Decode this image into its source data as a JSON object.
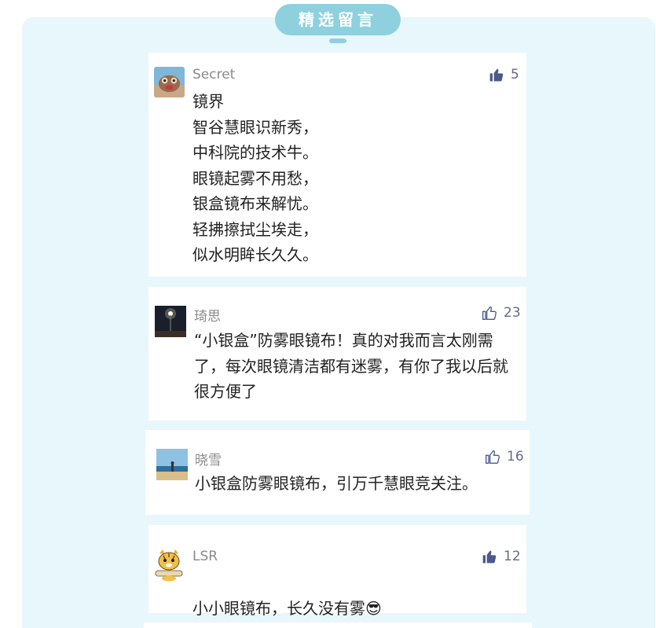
{
  "header": {
    "title": "精选留言"
  },
  "comments": [
    {
      "username": "Secret",
      "likes": "5",
      "liked": true,
      "text": "镜界\n智谷慧眼识新秀，\n中科院的技术牛。\n眼镜起雾不用愁，\n银盒镜布来解忧。\n轻拂擦拭尘埃走，\n似水明眸长久久。"
    },
    {
      "username": "琦思",
      "likes": "23",
      "liked": false,
      "text": "“小银盒”防雾眼镜布！真的对我而言太刚需了，每次眼镜清洁都有迷雾，有你了我以后就很方便了"
    },
    {
      "username": "晓雪",
      "likes": "16",
      "liked": false,
      "text": "小银盒防雾眼镜布，引万千慧眼竞关注。"
    },
    {
      "username": "LSR",
      "likes": "12",
      "liked": true,
      "text": "小小眼镜布，长久没有雾",
      "emoji": "😎"
    }
  ],
  "colors": {
    "panel_bg": "#e7f7fb",
    "title_pill": "#8fd0df",
    "like_icon": "#4a5a8c"
  },
  "icons": {
    "like_filled": "thumbs-up-filled-icon",
    "like_outline": "thumbs-up-outline-icon"
  }
}
